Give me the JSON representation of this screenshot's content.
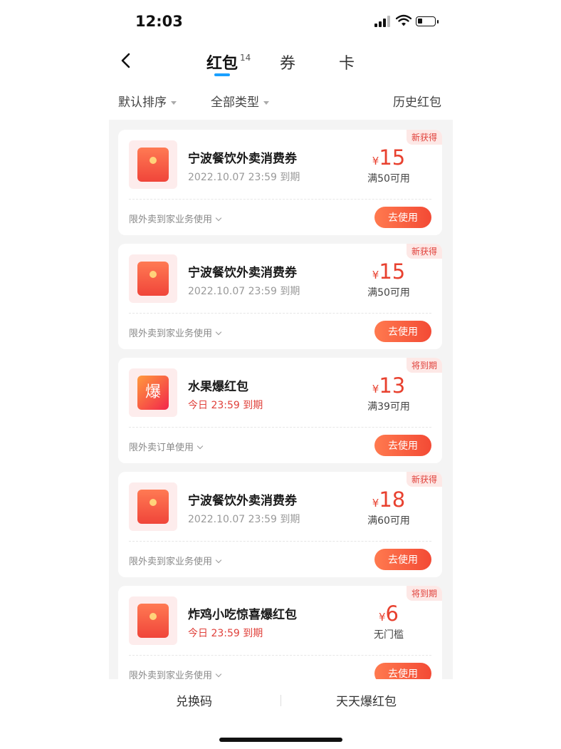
{
  "status": {
    "time": "12:03"
  },
  "nav": {
    "tabs": [
      {
        "label": "红包",
        "badge": "14"
      },
      {
        "label": "券"
      },
      {
        "label": "卡"
      }
    ]
  },
  "filters": {
    "sort": "默认排序",
    "type": "全部类型",
    "history": "历史红包"
  },
  "cards": [
    {
      "icon": "red-envelope-icon",
      "title": "宁波餐饮外卖消费券",
      "expiry": "2022.10.07 23:59 到期",
      "tag": "新获得",
      "currency": "¥",
      "amount": "15",
      "condition": "满50可用",
      "scope": "限外卖到家业务使用",
      "action": "去使用"
    },
    {
      "icon": "red-envelope-icon",
      "title": "宁波餐饮外卖消费券",
      "expiry": "2022.10.07 23:59 到期",
      "tag": "新获得",
      "currency": "¥",
      "amount": "15",
      "condition": "满50可用",
      "scope": "限外卖到家业务使用",
      "action": "去使用"
    },
    {
      "icon": "bao-icon",
      "icon_text": "爆",
      "title": "水果爆红包",
      "expiry": "今日 23:59 到期",
      "tag": "将到期",
      "currency": "¥",
      "amount": "13",
      "condition": "满39可用",
      "scope": "限外卖订单使用",
      "action": "去使用"
    },
    {
      "icon": "red-envelope-icon",
      "title": "宁波餐饮外卖消费券",
      "expiry": "2022.10.07 23:59 到期",
      "tag": "新获得",
      "currency": "¥",
      "amount": "18",
      "condition": "满60可用",
      "scope": "限外卖到家业务使用",
      "action": "去使用"
    },
    {
      "icon": "red-envelope-icon",
      "title": "炸鸡小吃惊喜爆红包",
      "expiry": "今日 23:59 到期",
      "tag": "将到期",
      "currency": "¥",
      "amount": "6",
      "condition": "无门槛",
      "scope": "限外卖到家业务使用",
      "action": "去使用"
    }
  ],
  "bottom": {
    "redeem": "兑换码",
    "daily": "天天爆红包"
  },
  "colors": {
    "accent": "#e8412f",
    "tab_indicator": "#1aa0ff"
  }
}
